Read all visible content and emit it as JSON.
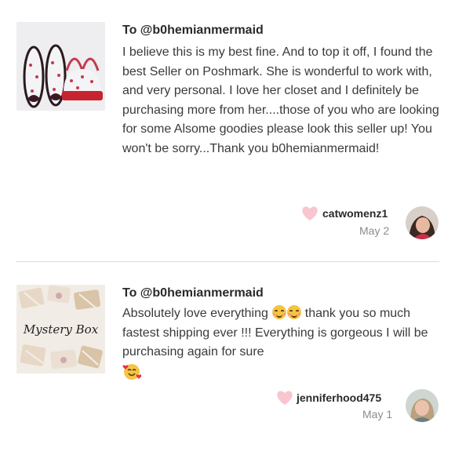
{
  "notes": [
    {
      "to_label": "To @b0hemianmermaid",
      "message": "I believe this is my best fine. And to top it off, I found the best Seller on Poshmark. She is wonderful to work with, and very personal. I love her closet and I definitely be purchasing more from her....those of you who are looking for some Alsome goodies please look this seller up! You won't be sorry...Thank you b0hemianmermaid!",
      "username": "catwomenz1",
      "date": "May 2",
      "thumbnail_icon": "shoes-and-bag-photo",
      "avatar_icon": "user-avatar"
    },
    {
      "to_label": "To @b0hemianmermaid",
      "message_before_emoji": "Absolutely love everything ",
      "message_after_emoji": " thank you so much fastest shipping ever !!! Everything is gorgeous I will be purchasing again for sure",
      "thumbnail_text": "Mystery Box",
      "username": "jenniferhood475",
      "date": "May 1",
      "thumbnail_icon": "mystery-box-photo",
      "avatar_icon": "user-avatar"
    }
  ],
  "colors": {
    "heart": "#f7c6cf",
    "divider": "#dcdcdc",
    "date": "#8c8c8c"
  }
}
